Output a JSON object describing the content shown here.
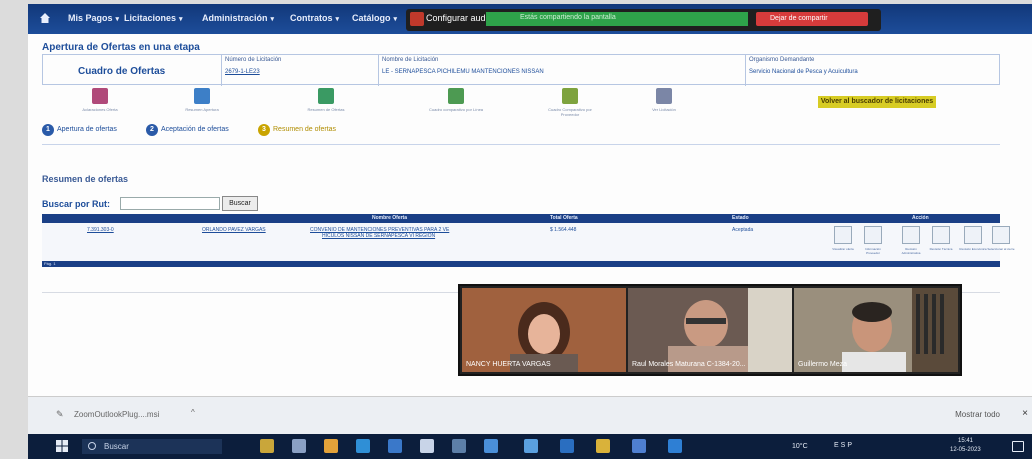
{
  "nav": {
    "items": [
      "Mis Pagos",
      "Licitaciones",
      "Administración",
      "Contratos",
      "Catálogo"
    ],
    "configurar": "Configurar aud",
    "share_status": "Estás compartiendo la pantalla",
    "stop_share": "Dejar de compartir"
  },
  "page": {
    "title": "Apertura de Ofertas en una etapa",
    "cuadro": "Cuadro de Ofertas",
    "headers": {
      "numero": "Número de Licitación",
      "nombre": "Nombre de Licitación",
      "organismo": "Organismo Demandante"
    },
    "values": {
      "numero": "2679-1-LE23",
      "nombre": "LE - SERNAPESCA PICHILEMU MANTENCIONES NISSAN",
      "organismo": "Servicio Nacional de Pesca y Acuicultura"
    }
  },
  "tools": [
    {
      "label": "Aclaraciones Oferta",
      "color": "#b04a7a",
      "icon": "clipboard-icon"
    },
    {
      "label": "Resumen Apertura",
      "color": "#3d7fc7",
      "icon": "globe-icon"
    },
    {
      "label": "Resumen de Ofertas",
      "color": "#3a9a63",
      "icon": "document-icon"
    },
    {
      "label": "Cuadro comparativo por Línea",
      "color": "#4d9a52",
      "icon": "table-icon"
    },
    {
      "label": "Cuadro Comparativo por Proveedor",
      "color": "#7ea33e",
      "icon": "chart-icon"
    },
    {
      "label": "Ver Licitación",
      "color": "#7b86a6",
      "icon": "file-icon"
    }
  ],
  "volver": "Volver al buscador de licitaciones",
  "steps": [
    {
      "num": "1",
      "label": "Apertura de ofertas"
    },
    {
      "num": "2",
      "label": "Aceptación de ofertas"
    },
    {
      "num": "3",
      "label": "Resumen de ofertas"
    }
  ],
  "resumen": {
    "title": "Resumen de ofertas",
    "search_label": "Buscar por Rut:",
    "search_button": "Buscar",
    "columns": [
      "Nombre Oferta",
      "Total Oferta",
      "Estado",
      "Acción"
    ],
    "row": {
      "rut": "7.391.303-0",
      "proveedor": "ORLANDO PAVEZ VARGAS",
      "oferta_1": "CONVENIO DE MANTENCIONES PREVENTIVAS PARA 2 VE",
      "oferta_2": "HICULOS NISSAN DE SERNAPESCA VI REGION",
      "total": "$ 1.564.448",
      "estado": "Aceptada"
    },
    "actions": [
      "Visualizar oferta",
      "Información Proveedor",
      "Revisión Administrativa",
      "Revisión Técnica",
      "Revisión Económica",
      "Seleccionar al cierre"
    ],
    "pagination": "Pág. 1"
  },
  "video": {
    "participants": [
      {
        "name": "NANCY HUERTA VARGAS",
        "bg": "#a0613e"
      },
      {
        "name": "Raul Morales Maturana C-1384-20...",
        "bg": "#6b5a52"
      },
      {
        "name": "Guillermo Meza",
        "bg": "#9a8f7d"
      }
    ]
  },
  "downloads": {
    "file": "ZoomOutlookPlug....msi",
    "show_all": "Mostrar todo"
  },
  "taskbar": {
    "search": "Buscar",
    "weather": "10°C",
    "tray": "ESP",
    "time": "15:41",
    "date": "12-05-2023",
    "apps": [
      {
        "icon": "badge-icon",
        "color": "#c9a63a"
      },
      {
        "icon": "task-view-icon",
        "color": "#8aa0c4"
      },
      {
        "icon": "chrome-icon",
        "color": "#e3a23a"
      },
      {
        "icon": "edge-icon",
        "color": "#2f8fd6"
      },
      {
        "icon": "mail-icon",
        "color": "#3a78c9"
      },
      {
        "icon": "explorer-icon",
        "color": "#c8d4e8"
      },
      {
        "icon": "calculator-icon",
        "color": "#5d7fa8"
      },
      {
        "icon": "meet-icon",
        "color": "#4a8fd9"
      },
      {
        "icon": "shield-icon",
        "color": "#5aa0e0"
      },
      {
        "icon": "vm-icon",
        "color": "#2a6ec0"
      },
      {
        "icon": "folder-icon",
        "color": "#d9b23a"
      },
      {
        "icon": "teams-icon",
        "color": "#4f7fd0"
      },
      {
        "icon": "outlook-icon",
        "color": "#2e7fd4"
      }
    ]
  }
}
